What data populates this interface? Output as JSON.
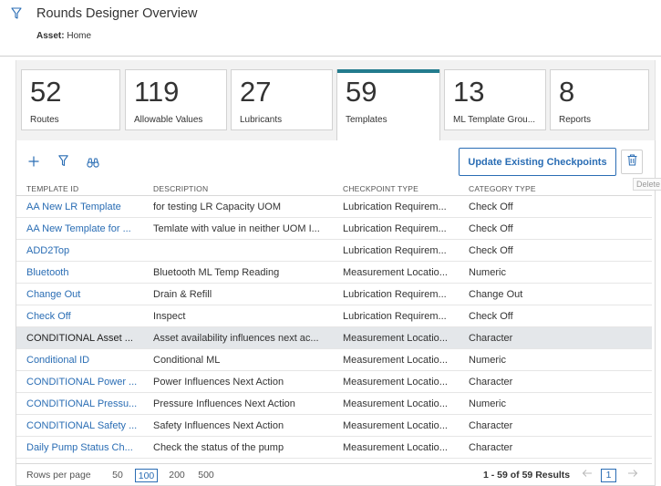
{
  "header": {
    "filter_icon": "filter-icon",
    "title": "Rounds Designer Overview",
    "asset_label": "Asset:",
    "asset_value": "Home"
  },
  "tiles": [
    {
      "count": "52",
      "label": "Routes"
    },
    {
      "count": "119",
      "label": "Allowable Values"
    },
    {
      "count": "27",
      "label": "Lubricants"
    },
    {
      "count": "59",
      "label": "Templates"
    },
    {
      "count": "13",
      "label": "ML Template Grou..."
    },
    {
      "count": "8",
      "label": "Reports"
    }
  ],
  "active_tile": "Templates",
  "toolbar": {
    "add_icon": "plus-icon",
    "filter_icon": "filter-icon",
    "find_icon": "binoculars-icon",
    "update_button": "Update Existing Checkpoints",
    "delete_icon": "trash-icon",
    "delete_tooltip": "Delete"
  },
  "table": {
    "columns": [
      "TEMPLATE ID",
      "DESCRIPTION",
      "CHECKPOINT TYPE",
      "CATEGORY TYPE"
    ],
    "rows": [
      [
        "AA New LR Template",
        "for testing LR Capacity UOM",
        "Lubrication Requirem...",
        "Check Off"
      ],
      [
        "AA New Template for ...",
        "Temlate with value in neither UOM I...",
        "Lubrication Requirem...",
        "Check Off"
      ],
      [
        "ADD2Top",
        "",
        "Lubrication Requirem...",
        "Check Off"
      ],
      [
        "Bluetooth",
        "Bluetooth ML Temp Reading",
        "Measurement Locatio...",
        "Numeric"
      ],
      [
        "Change Out",
        "Drain & Refill",
        "Lubrication Requirem...",
        "Change Out"
      ],
      [
        "Check Off",
        "Inspect",
        "Lubrication Requirem...",
        "Check Off"
      ],
      [
        "CONDITIONAL Asset ...",
        "Asset availability influences next ac...",
        "Measurement Locatio...",
        "Character"
      ],
      [
        "Conditional ID",
        "Conditional ML",
        "Measurement Locatio...",
        "Numeric"
      ],
      [
        "CONDITIONAL Power ...",
        "Power Influences Next Action",
        "Measurement Locatio...",
        "Character"
      ],
      [
        "CONDITIONAL Pressu...",
        "Pressure Influences Next Action",
        "Measurement Locatio...",
        "Numeric"
      ],
      [
        "CONDITIONAL Safety ...",
        "Safety Influences Next Action",
        "Measurement Locatio...",
        "Character"
      ],
      [
        "Daily Pump Status Ch...",
        "Check the status of the pump",
        "Measurement Locatio...",
        "Character"
      ]
    ],
    "selected_row": 6
  },
  "footer": {
    "rows_per_page_label": "Rows per page",
    "options": [
      "50",
      "100",
      "200",
      "500"
    ],
    "selected_option": "100",
    "results": "1 - 59 of 59 Results",
    "prev_icon": "arrow-left-icon",
    "page": "1",
    "next_icon": "arrow-right-icon"
  },
  "colors": {
    "accent": "#237c8e",
    "link": "#2a6db4",
    "selected_row": "#e4e7ea"
  }
}
